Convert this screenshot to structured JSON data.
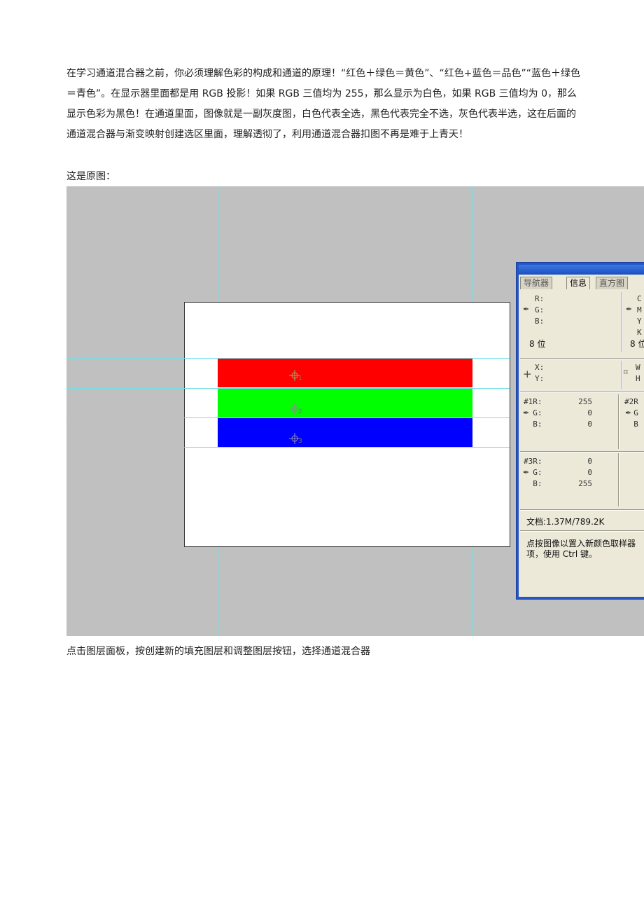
{
  "paragraph_intro": "在学习通道混合器之前，你必须理解色彩的构成和通道的原理！“红色＋绿色＝黄色”、“红色+蓝色＝品色”“蓝色＋绿色＝青色”。在显示器里面都是用 RGB 投影！如果 RGB 三值均为 255，那么显示为白色，如果 RGB 三值均为 0，那么显示色彩为黑色！在通道里面，图像就是一副灰度图，白色代表全选，黑色代表完全不选，灰色代表半选，这在后面的通道混合器与渐变映射创建选区里面，理解透彻了，利用通道混合器扣图不再是难于上青天！",
  "caption_original": "这是原图：",
  "caption_next": "点击图层面板，按创建新的填充图层和调整图层按钮，选择通道混合器",
  "screenshot": {
    "tabs": [
      "导航器",
      "信息",
      "直方图"
    ],
    "info": {
      "rgb_labels": "R:\nG:\nB:",
      "cmyk_labels": "C\nM\nY\nK",
      "bit_depth_left": "8 位",
      "bit_depth_right": "8 位",
      "xy_labels": "X:\nY:",
      "wh_labels": "W\nH",
      "s1_labels": "#1R:\n  G:\n  B:",
      "s1_values": "255\n0\n0",
      "s2_labels": "#2R\n  G\n  B",
      "s3_labels": "#3R:\n  G:\n  B:",
      "s3_values": "0\n0\n255",
      "doc_size": "文档:1.37M/789.2K",
      "hint_line1": "点按图像以置入新颜色取样器",
      "hint_line2": "项，使用 Ctrl 键。"
    },
    "sampler_numbers": [
      "1",
      "2",
      "3"
    ],
    "colors": {
      "canvas_bg": "#c0c0c0",
      "red": "#ff0000",
      "green": "#00ff00",
      "blue": "#0000ff",
      "guide": "#6fdfe6"
    }
  }
}
